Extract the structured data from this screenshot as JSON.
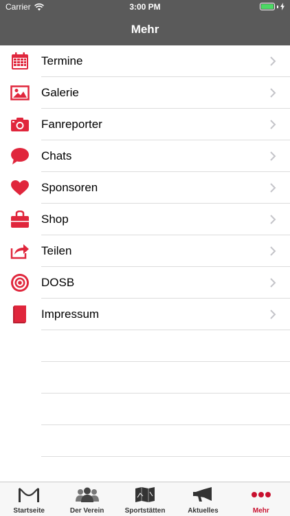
{
  "status": {
    "carrier": "Carrier",
    "time": "3:00 PM"
  },
  "nav": {
    "title": "Mehr"
  },
  "colors": {
    "accent": "#e0263c",
    "active_tab": "#c8102e",
    "bar": "#5a5a5a"
  },
  "menu": [
    {
      "label": "Termine",
      "icon": "calendar-icon"
    },
    {
      "label": "Galerie",
      "icon": "image-icon"
    },
    {
      "label": "Fanreporter",
      "icon": "camera-icon"
    },
    {
      "label": "Chats",
      "icon": "chat-bubble-icon"
    },
    {
      "label": "Sponsoren",
      "icon": "heart-icon"
    },
    {
      "label": "Shop",
      "icon": "shopping-bag-icon"
    },
    {
      "label": "Teilen",
      "icon": "share-icon"
    },
    {
      "label": "DOSB",
      "icon": "target-icon"
    },
    {
      "label": "Impressum",
      "icon": "book-icon"
    }
  ],
  "tabs": [
    {
      "label": "Startseite",
      "icon": "gate-icon"
    },
    {
      "label": "Der Verein",
      "icon": "people-icon"
    },
    {
      "label": "Sportstätten",
      "icon": "map-icon"
    },
    {
      "label": "Aktuelles",
      "icon": "megaphone-icon"
    },
    {
      "label": "Mehr",
      "icon": "more-dots-icon"
    }
  ]
}
